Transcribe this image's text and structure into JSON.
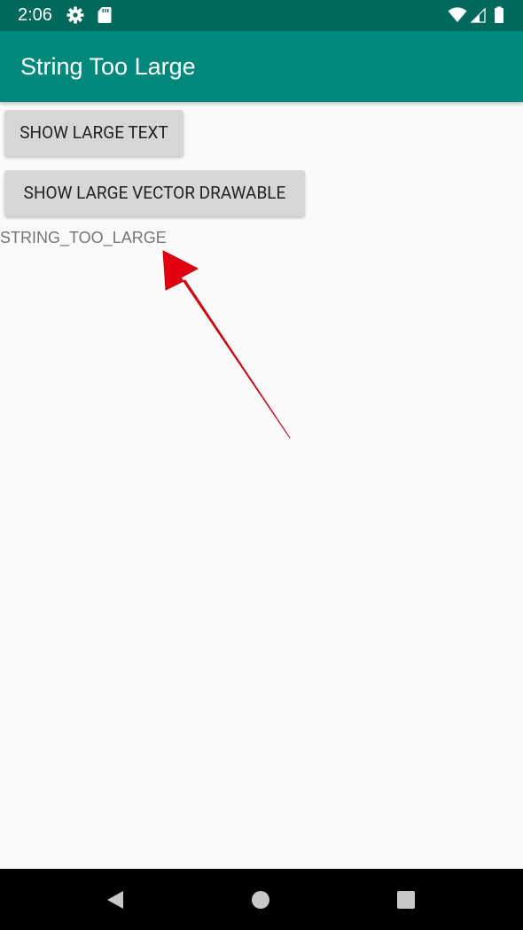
{
  "status_bar": {
    "time": "2:06",
    "icons": [
      "settings-icon",
      "sd-card-icon",
      "wifi-icon",
      "signal-icon",
      "battery-icon"
    ]
  },
  "app_bar": {
    "title": "String Too Large"
  },
  "buttons": {
    "show_large_text": "SHOW LARGE TEXT",
    "show_large_vector": "SHOW LARGE VECTOR DRAWABLE"
  },
  "result": {
    "text": "STRING_TOO_LARGE"
  },
  "annotation": {
    "arrow_color": "#e0000f"
  },
  "nav_bar": {
    "icons": [
      "back-icon",
      "home-icon",
      "recents-icon"
    ]
  },
  "colors": {
    "status_bar": "#00695c",
    "app_bar": "#00897b",
    "background": "#fafafa",
    "button": "#d6d7d7",
    "result_text": "#757575"
  }
}
